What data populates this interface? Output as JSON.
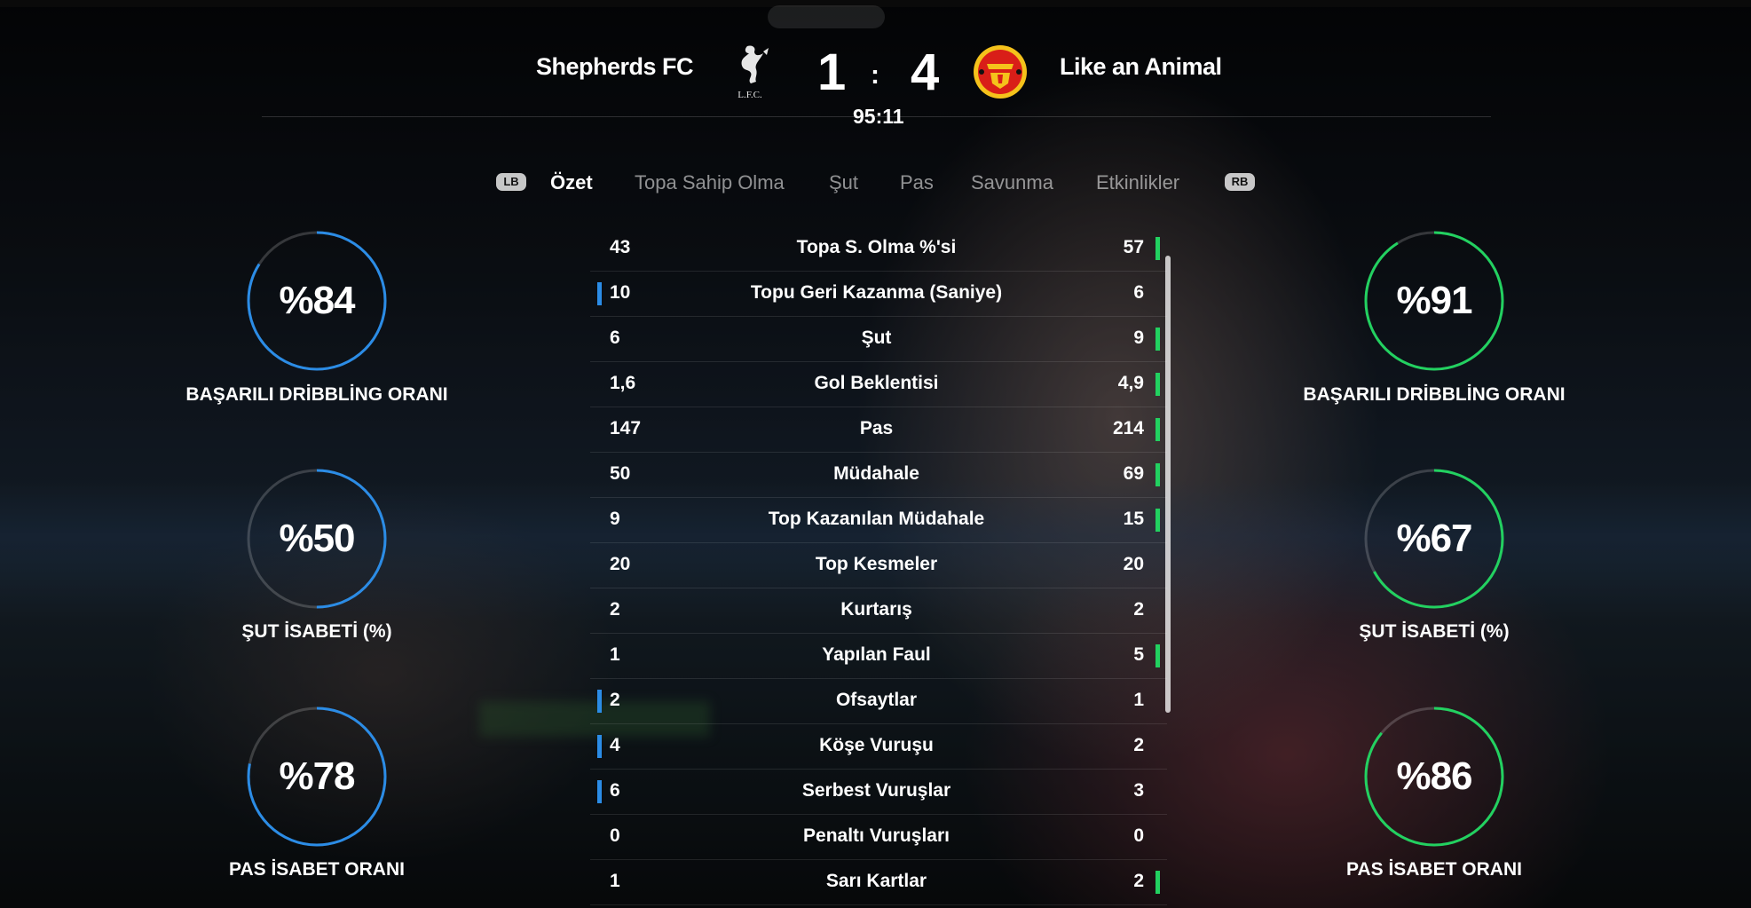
{
  "match": {
    "home_team": "Shepherds FC",
    "away_team": "Like an Animal",
    "home_score": "1",
    "away_score": "4",
    "separator": ":",
    "clock": "95:11",
    "home_crest_text": "L.F.C."
  },
  "tabs": {
    "left_bumper": "LB",
    "right_bumper": "RB",
    "items": [
      "Özet",
      "Topa Sahip Olma",
      "Şut",
      "Pas",
      "Savunma",
      "Etkinlikler"
    ],
    "active": "Özet"
  },
  "colors": {
    "home": "#2b8ce6",
    "away": "#22d160"
  },
  "home_dials": [
    {
      "value": "%84",
      "fraction": 0.84,
      "label": "BAŞARILI DRİBBLİNG ORANI"
    },
    {
      "value": "%50",
      "fraction": 0.5,
      "label": "ŞUT İSABETİ (%)"
    },
    {
      "value": "%78",
      "fraction": 0.78,
      "label": "PAS İSABET ORANI"
    }
  ],
  "away_dials": [
    {
      "value": "%91",
      "fraction": 0.91,
      "label": "BAŞARILI DRİBBLİNG ORANI"
    },
    {
      "value": "%67",
      "fraction": 0.67,
      "label": "ŞUT İSABETİ (%)"
    },
    {
      "value": "%86",
      "fraction": 0.86,
      "label": "PAS İSABET ORANI"
    }
  ],
  "stats": [
    {
      "home": "43",
      "label": "Topa S. Olma %'si",
      "away": "57",
      "lead": "away"
    },
    {
      "home": "10",
      "label": "Topu Geri Kazanma (Saniye)",
      "away": "6",
      "lead": "home"
    },
    {
      "home": "6",
      "label": "Şut",
      "away": "9",
      "lead": "away"
    },
    {
      "home": "1,6",
      "label": "Gol Beklentisi",
      "away": "4,9",
      "lead": "away"
    },
    {
      "home": "147",
      "label": "Pas",
      "away": "214",
      "lead": "away"
    },
    {
      "home": "50",
      "label": "Müdahale",
      "away": "69",
      "lead": "away"
    },
    {
      "home": "9",
      "label": "Top Kazanılan Müdahale",
      "away": "15",
      "lead": "away"
    },
    {
      "home": "20",
      "label": "Top Kesmeler",
      "away": "20",
      "lead": "none"
    },
    {
      "home": "2",
      "label": "Kurtarış",
      "away": "2",
      "lead": "none"
    },
    {
      "home": "1",
      "label": "Yapılan Faul",
      "away": "5",
      "lead": "away"
    },
    {
      "home": "2",
      "label": "Ofsaytlar",
      "away": "1",
      "lead": "home"
    },
    {
      "home": "4",
      "label": "Köşe Vuruşu",
      "away": "2",
      "lead": "home"
    },
    {
      "home": "6",
      "label": "Serbest Vuruşlar",
      "away": "3",
      "lead": "home"
    },
    {
      "home": "0",
      "label": "Penaltı Vuruşları",
      "away": "0",
      "lead": "none"
    },
    {
      "home": "1",
      "label": "Sarı Kartlar",
      "away": "2",
      "lead": "away"
    }
  ]
}
